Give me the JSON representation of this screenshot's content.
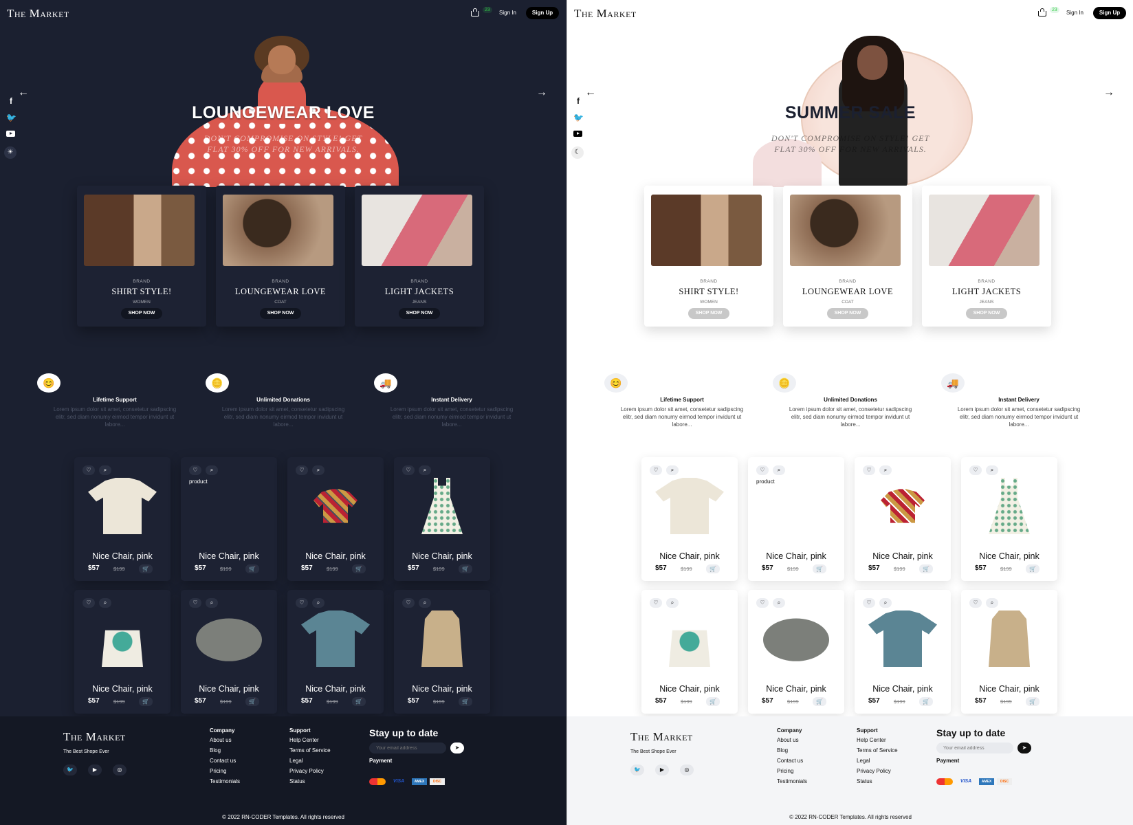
{
  "colors": {
    "dark_bg": "#1b2030",
    "light_bg": "#ffffff",
    "accent": "#000000",
    "badge_green": "#33cc44"
  },
  "panels": [
    {
      "theme": "dark",
      "header": {
        "logo": "The Market",
        "cart_count": "23",
        "signin": "Sign In",
        "signup": "Sign Up"
      },
      "hero": {
        "title": "LOUNGEWEAR LOVE",
        "subtitle_1": "DON'T COMPROMISE ON STYLE! GET",
        "subtitle_2": "FLAT 30% OFF FOR NEW ARRIVALS."
      },
      "mode_icon": "sun-icon",
      "mode_glyph": "☀"
    },
    {
      "theme": "light",
      "header": {
        "logo": "The Market",
        "cart_count": "23",
        "signin": "Sign In",
        "signup": "Sign Up"
      },
      "hero": {
        "title": "SUMMER SALE",
        "subtitle_1": "DON'T COMPROMISE ON STYLE! GET",
        "subtitle_2": "FLAT 30% OFF FOR NEW ARRIVALS."
      },
      "mode_icon": "moon-icon",
      "mode_glyph": "☾"
    }
  ],
  "categories": [
    {
      "brand": "BRAND",
      "title": "SHIRT STYLE!",
      "sub": "WOMEN",
      "button": "SHOP NOW"
    },
    {
      "brand": "BRAND",
      "title": "LOUNGEWEAR LOVE",
      "sub": "COAT",
      "button": "SHOP NOW"
    },
    {
      "brand": "BRAND",
      "title": "LIGHT JACKETS",
      "sub": "JEANS",
      "button": "SHOP NOW"
    }
  ],
  "features": [
    {
      "title": "Lifetime Support",
      "desc_1": "Lorem ipsum dolor sit amet, consetetur sadipscing",
      "desc_2": "elitr, sed diam nonumy eirmod tempor invidunt ut",
      "desc_3": "labore...",
      "icon": "support-face-icon"
    },
    {
      "title": "Unlimited Donations",
      "desc_1": "Lorem ipsum dolor sit amet, consetetur sadipscing",
      "desc_2": "elitr, sed diam nonumy eirmod tempor invidunt ut",
      "desc_3": "labore...",
      "icon": "donation-coin-icon"
    },
    {
      "title": "Instant Delivery",
      "desc_1": "Lorem ipsum dolor sit amet, consetetur sadipscing",
      "desc_2": "elitr, sed diam nonumy eirmod tempor invidunt ut",
      "desc_3": "labore...",
      "icon": "delivery-truck-icon"
    }
  ],
  "products": [
    {
      "name": "Nice Chair, pink",
      "price": "$57",
      "old": "$199",
      "image": "tshirt-cream"
    },
    {
      "name": "Nice Chair, pink",
      "price": "$57",
      "old": "$199",
      "image": "broken",
      "alt": "product"
    },
    {
      "name": "Nice Chair, pink",
      "price": "$57",
      "old": "$199",
      "image": "shirt-print"
    },
    {
      "name": "Nice Chair, pink",
      "price": "$57",
      "old": "$199",
      "image": "dress-floral"
    },
    {
      "name": "Nice Chair, pink",
      "price": "$57",
      "old": "$199",
      "image": "tote-bag"
    },
    {
      "name": "Nice Chair, pink",
      "price": "$57",
      "old": "$199",
      "image": "cap-grey"
    },
    {
      "name": "Nice Chair, pink",
      "price": "$57",
      "old": "$199",
      "image": "tshirt-teal"
    },
    {
      "name": "Nice Chair, pink",
      "price": "$57",
      "old": "$199",
      "image": "trench-coat"
    }
  ],
  "footer": {
    "logo": "The Market",
    "tagline": "The Best Shope Ever",
    "company_heading": "Company",
    "company_links": [
      "About us",
      "Blog",
      "Contact us",
      "Pricing",
      "Testimonials"
    ],
    "support_heading": "Support",
    "support_links": [
      "Help Center",
      "Terms of Service",
      "Legal",
      "Privacy Policy",
      "Status"
    ],
    "stay_title": "Stay up to date",
    "email_placeholder": "Your email address",
    "payment_heading": "Payment",
    "payment_cards": [
      "MC",
      "VISA",
      "AMEX",
      "DISC"
    ],
    "copyright": "© 2022 RN-CODER Templates. All rights reserved"
  }
}
